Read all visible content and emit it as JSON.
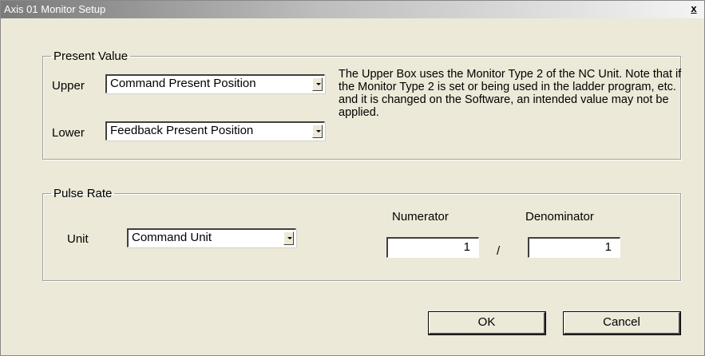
{
  "window": {
    "title": "Axis 01 Monitor Setup",
    "close_glyph": "x"
  },
  "present_value": {
    "legend": "Present Value",
    "upper_label": "Upper",
    "upper_value": "Command Present Position",
    "lower_label": "Lower",
    "lower_value": "Feedback Present Position",
    "note": "The Upper Box uses the Monitor Type 2 of the NC Unit. Note that if the Monitor Type 2 is set or being used in the ladder program, etc. and it is changed on the Software, an intended value may not be applied."
  },
  "pulse_rate": {
    "legend": "Pulse Rate",
    "unit_label": "Unit",
    "unit_value": "Command Unit",
    "numerator_label": "Numerator",
    "numerator_value": "1",
    "separator": "/",
    "denominator_label": "Denominator",
    "denominator_value": "1"
  },
  "buttons": {
    "ok": "OK",
    "cancel": "Cancel"
  },
  "icons": {
    "dropdown": "chevron-down-icon"
  }
}
